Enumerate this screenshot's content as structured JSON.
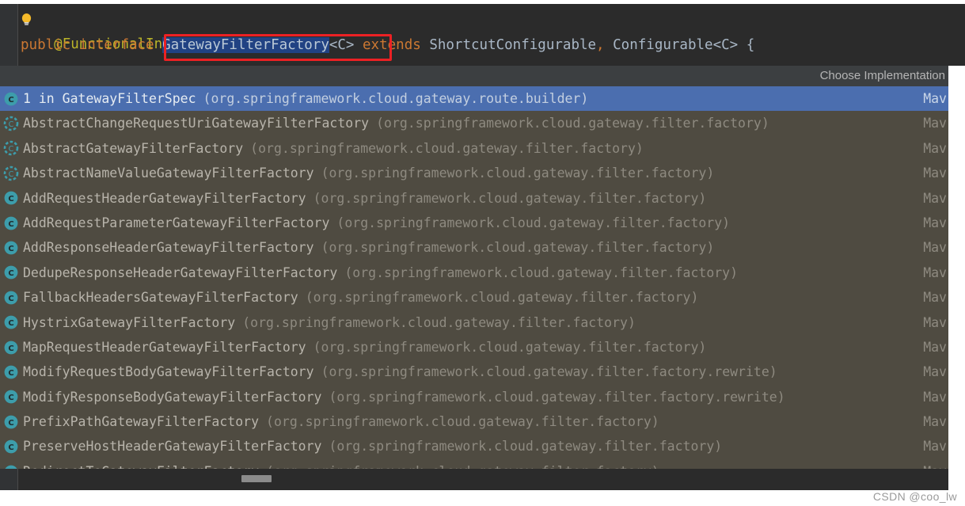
{
  "editor": {
    "line1": {
      "annotation": "@FunctionalInterface",
      "bulb_icon": "lightbulb-icon"
    },
    "line2": {
      "modifier": "public",
      "keyword_interface": "interface",
      "selected_type": "GatewayFilterFactory",
      "generic": "<C>",
      "keyword_extends": "extends",
      "super1": "ShortcutConfigurable",
      "separator": ",",
      "super2": "Configurable<C>",
      "brace": "{"
    },
    "annotation_box_color": "#ec2124",
    "selection_color": "#214283"
  },
  "popup": {
    "title": "Choose Implementation",
    "selected_index": 0,
    "module_label": "Mav",
    "rows": [
      {
        "icon": "class-icon",
        "name": "1 in GatewayFilterSpec",
        "package": "(org.springframework.cloud.gateway.route.builder)",
        "module": "Mav",
        "abstract": false
      },
      {
        "icon": "abstract-class-icon",
        "name": "AbstractChangeRequestUriGatewayFilterFactory",
        "package": "(org.springframework.cloud.gateway.filter.factory)",
        "module": "Mav",
        "abstract": true
      },
      {
        "icon": "abstract-class-icon",
        "name": "AbstractGatewayFilterFactory",
        "package": "(org.springframework.cloud.gateway.filter.factory)",
        "module": "Mav",
        "abstract": true
      },
      {
        "icon": "abstract-class-icon",
        "name": "AbstractNameValueGatewayFilterFactory",
        "package": "(org.springframework.cloud.gateway.filter.factory)",
        "module": "Mav",
        "abstract": true
      },
      {
        "icon": "class-icon",
        "name": "AddRequestHeaderGatewayFilterFactory",
        "package": "(org.springframework.cloud.gateway.filter.factory)",
        "module": "Mav",
        "abstract": false
      },
      {
        "icon": "class-icon",
        "name": "AddRequestParameterGatewayFilterFactory",
        "package": "(org.springframework.cloud.gateway.filter.factory)",
        "module": "Mav",
        "abstract": false
      },
      {
        "icon": "class-icon",
        "name": "AddResponseHeaderGatewayFilterFactory",
        "package": "(org.springframework.cloud.gateway.filter.factory)",
        "module": "Mav",
        "abstract": false
      },
      {
        "icon": "class-icon",
        "name": "DedupeResponseHeaderGatewayFilterFactory",
        "package": "(org.springframework.cloud.gateway.filter.factory)",
        "module": "Mav",
        "abstract": false
      },
      {
        "icon": "class-icon",
        "name": "FallbackHeadersGatewayFilterFactory",
        "package": "(org.springframework.cloud.gateway.filter.factory)",
        "module": "Mav",
        "abstract": false
      },
      {
        "icon": "class-icon",
        "name": "HystrixGatewayFilterFactory",
        "package": "(org.springframework.cloud.gateway.filter.factory)",
        "module": "Mav",
        "abstract": false
      },
      {
        "icon": "class-icon",
        "name": "MapRequestHeaderGatewayFilterFactory",
        "package": "(org.springframework.cloud.gateway.filter.factory)",
        "module": "Mav",
        "abstract": false
      },
      {
        "icon": "class-icon",
        "name": "ModifyRequestBodyGatewayFilterFactory",
        "package": "(org.springframework.cloud.gateway.filter.factory.rewrite)",
        "module": "Mav",
        "abstract": false
      },
      {
        "icon": "class-icon",
        "name": "ModifyResponseBodyGatewayFilterFactory",
        "package": "(org.springframework.cloud.gateway.filter.factory.rewrite)",
        "module": "Mav",
        "abstract": false
      },
      {
        "icon": "class-icon",
        "name": "PrefixPathGatewayFilterFactory",
        "package": "(org.springframework.cloud.gateway.filter.factory)",
        "module": "Mav",
        "abstract": false
      },
      {
        "icon": "class-icon",
        "name": "PreserveHostHeaderGatewayFilterFactory",
        "package": "(org.springframework.cloud.gateway.filter.factory)",
        "module": "Mav",
        "abstract": false
      },
      {
        "icon": "class-icon",
        "name": "RedirectToGatewayFilterFactory",
        "package": "(org.springframework.cloud.gateway.filter.factory)",
        "module": "Mav",
        "abstract": false
      }
    ]
  },
  "watermark": "CSDN @coo_lw"
}
